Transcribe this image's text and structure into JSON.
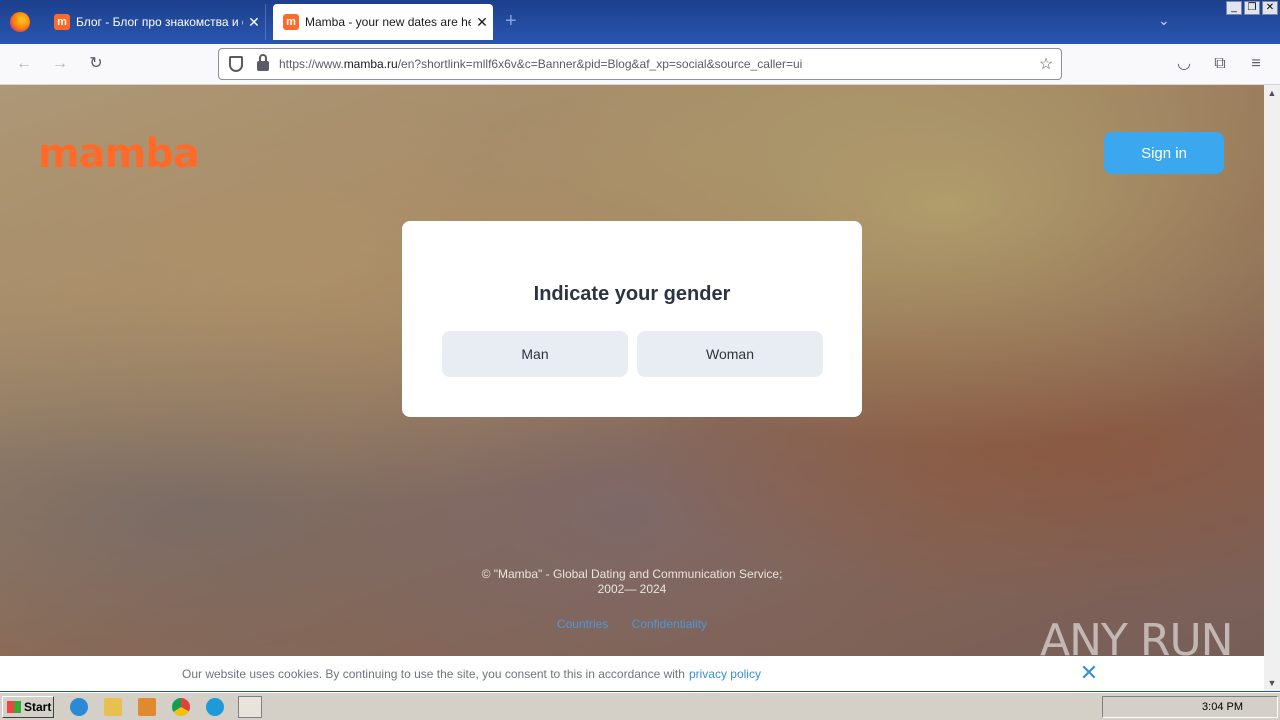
{
  "browser": {
    "tabs": [
      {
        "label": "Блог - Блог про знакомства и отн",
        "favicon": "m",
        "active": false
      },
      {
        "label": "Mamba - your new dates are here",
        "favicon": "m",
        "active": true
      }
    ],
    "new_tab_label": "+",
    "url_prefix": "https://www.",
    "url_domain": "mamba.ru",
    "url_rest": "/en?shortlink=mllf6x6v&c=Banner&pid=Blog&af_xp=social&source_caller=ui"
  },
  "page": {
    "logo": "mamba",
    "signin_label": "Sign in",
    "modal": {
      "title": "Indicate your gender",
      "man_label": "Man",
      "woman_label": "Woman"
    },
    "footer": {
      "copyright_line1": "© \"Mamba\" - Global Dating and Communication Service;",
      "copyright_line2": "2002— 2024",
      "links": [
        "Countries",
        "Confidentiality"
      ]
    },
    "watermark": "ANY RUN",
    "cookie": {
      "text": "Our website uses cookies. By continuing to use the site, you consent to this in accordance with",
      "link": "privacy policy",
      "close": "✕"
    }
  },
  "taskbar": {
    "start_label": "Start",
    "clock": "3:04 PM"
  },
  "colors": {
    "brand": "#ff6a2b",
    "signin": "#3ba7ee",
    "link": "#3b8ed8"
  }
}
